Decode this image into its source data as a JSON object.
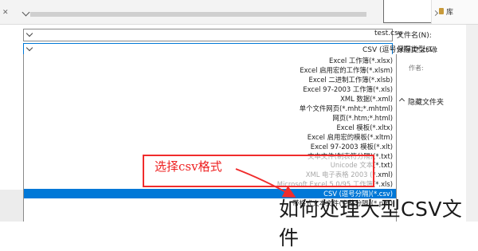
{
  "library": {
    "label": "库"
  },
  "file_name": {
    "label": "文件名(N):",
    "value": "test.csv"
  },
  "save_type": {
    "label": "保存类型(T):",
    "value": "CSV (逗号分隔)(*.csv)"
  },
  "author": {
    "label": "作者:"
  },
  "hide_folders": {
    "label": "隐藏文件夹"
  },
  "file_types": [
    "Excel 工作簿(*.xlsx)",
    "Excel 启用宏的工作簿(*.xlsm)",
    "Excel 二进制工作簿(*.xlsb)",
    "Excel 97-2003 工作簿(*.xls)",
    "XML 数据(*.xml)",
    "单个文件网页(*.mht;*.mhtml)",
    "网页(*.htm;*.html)",
    "Excel 模板(*.xltx)",
    "Excel 启用宏的模板(*.xltm)",
    "Excel 97-2003 模板(*.xlt)",
    "文本文件(制表符分隔)(*.txt)",
    "Unicode 文本(*.txt)",
    "XML 电子表格 2003 (*.xml)",
    "Microsoft Excel 5.0/95 工作簿(*.xls)",
    "CSV (逗号分隔)(*.csv)",
    "带格式文本文件(空格分隔)(*.prn)"
  ],
  "selected_index": 14,
  "annotation": {
    "text": "选择csv格式",
    "color": "#ee2020"
  },
  "watermark": {
    "text": "如何处理大型CSV文件"
  },
  "colors": {
    "selection": "#0078d7",
    "annotation": "#f02c2c"
  }
}
